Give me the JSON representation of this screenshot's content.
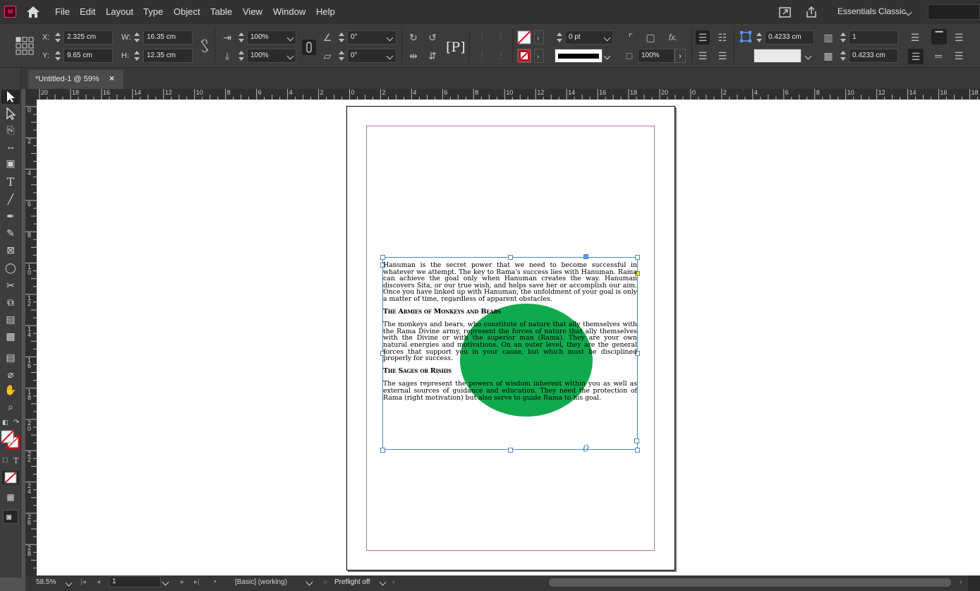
{
  "menubar": {
    "logo": "Id",
    "items": [
      "File",
      "Edit",
      "Layout",
      "Type",
      "Object",
      "Table",
      "View",
      "Window",
      "Help"
    ],
    "workspace": "Essentials Classic"
  },
  "control": {
    "x_label": "X:",
    "x": "2.325 cm",
    "y_label": "Y:",
    "y": "9.65 cm",
    "w_label": "W:",
    "w": "16.35 cm",
    "h_label": "H:",
    "h": "12.35 cm",
    "scale_x": "100%",
    "scale_y": "100%",
    "rotate": "0°",
    "shear": "0°",
    "stroke_weight": "0 pt",
    "opacity": "100%",
    "gap_left": "0.4233 cm",
    "gap_right": "0.4233 cm",
    "columns": "1"
  },
  "tab": {
    "label": "*Untitled-1 @ 59%",
    "close": "×"
  },
  "ruler": {
    "h": [
      "20",
      "18",
      "16",
      "14",
      "12",
      "10",
      "8",
      "6",
      "4",
      "2",
      "0",
      "2",
      "4",
      "6",
      "8",
      "10",
      "12",
      "14",
      "16",
      "18",
      "20",
      "0",
      "2",
      "4",
      "6",
      "8",
      "10",
      "12",
      "14",
      "16",
      "18"
    ],
    "v": [
      "0",
      "2",
      "4",
      "6",
      "8",
      "1 0",
      "1 2",
      "1 4",
      "1 6",
      "1 8",
      "2 0",
      "2 2",
      "2 4",
      "2 6",
      "2 8"
    ]
  },
  "story": {
    "p1": "Hanuman is the secret power that we need to become successful in whatever we attempt. The key to Rama's success lies with Hanuman. Rama can achieve the goal only when Hanuman creates the way. Hanuman discovers Sita, or our true wish, and helps save her or accomplish our aim. Once you have linked up with Hanuman, the unfoldment of your goal is only a matter of time, regardless of apparent obstacles.",
    "h1": "The Armies of Monkeys and Bears",
    "p2": "The monkeys and bears, who constitute of nature that ally themselves with the Rama Divine army, represent the forces of nature that ally themselves with the Divine or with the superior man (Rama). They are your own natural energies and motivations. On an outer level, they are the general forces that support you in your cause, but which must be disciplined properly for success.",
    "h2": "The Sages or Rishis",
    "p3": "The sages represent the powers of wisdom inherent within you as well as external sources of guidance and education. They need the protection of Rama (right motivation) but also serve to guide Rama to his goal."
  },
  "status": {
    "zoom": "58.5%",
    "page": "1",
    "style": "[Basic] (working)",
    "preflight": "Preflight off"
  }
}
